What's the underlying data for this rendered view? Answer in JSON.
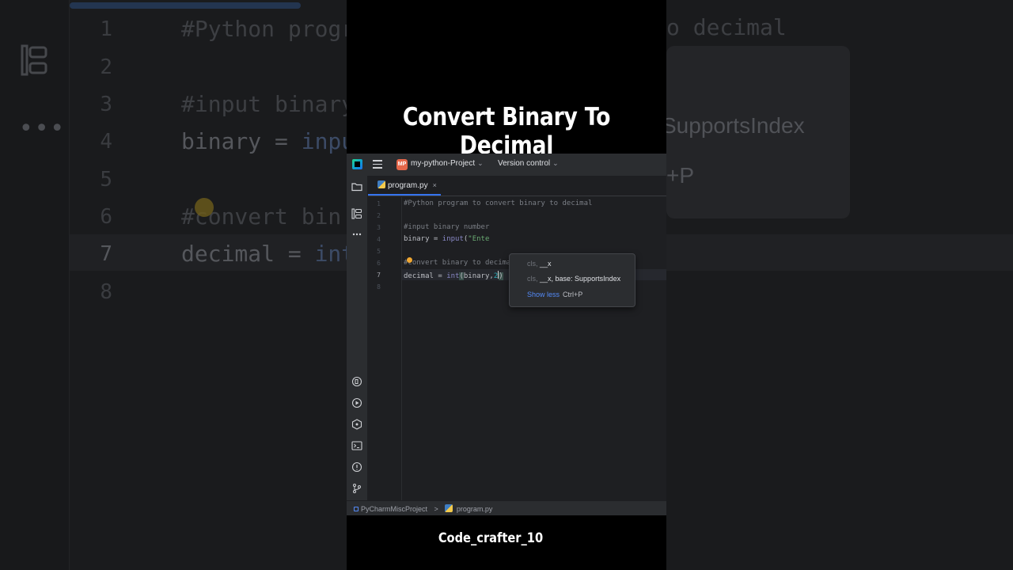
{
  "video": {
    "title": "Convert Binary To Decimal",
    "credit": "Code_crafter_10"
  },
  "ide": {
    "project_badge": "MP",
    "project_name": "my-python-Project",
    "vcs_label": "Version control",
    "tab": {
      "label": "program.py",
      "close": "×"
    },
    "status": {
      "root": "PyCharmMiscProject",
      "separator": ">",
      "file": "program.py"
    },
    "popup": {
      "row1_dim": "cls, ",
      "row1_hi": "__x",
      "row2_dim": "cls, ",
      "row2_hi": "__x, base: SupportsIndex",
      "link": "Show less",
      "shortcut": "Ctrl+P"
    },
    "line_numbers": [
      "1",
      "2",
      "3",
      "4",
      "5",
      "6",
      "7",
      "8"
    ],
    "code": {
      "line1": "#Python program to convert binary to decimal",
      "line3": "#input binary number",
      "line4_var": "binary = ",
      "line4_fn": "input",
      "line4_rest": "(",
      "line4_str": "\"Ente",
      "line6": "#convert binary to decimal",
      "line7_var": "decimal = ",
      "line7_fn": "int",
      "line7_open": "(",
      "line7_args": "binary,",
      "line7_num": "2",
      "line7_close": ")"
    }
  },
  "background": {
    "title_left": "#Python progr",
    "title_right": "o decimal",
    "line3": "#input binary",
    "line4_var": "binary = ",
    "line4_fn": "inpu",
    "line6": "#convert bin",
    "line7_var": "decimal = ",
    "line7_fn": "int",
    "popup_text": "SupportsIndex",
    "popup_text2": "+P",
    "line_numbers": [
      "1",
      "2",
      "3",
      "4",
      "5",
      "6",
      "7",
      "8"
    ],
    "dots": "•••"
  }
}
